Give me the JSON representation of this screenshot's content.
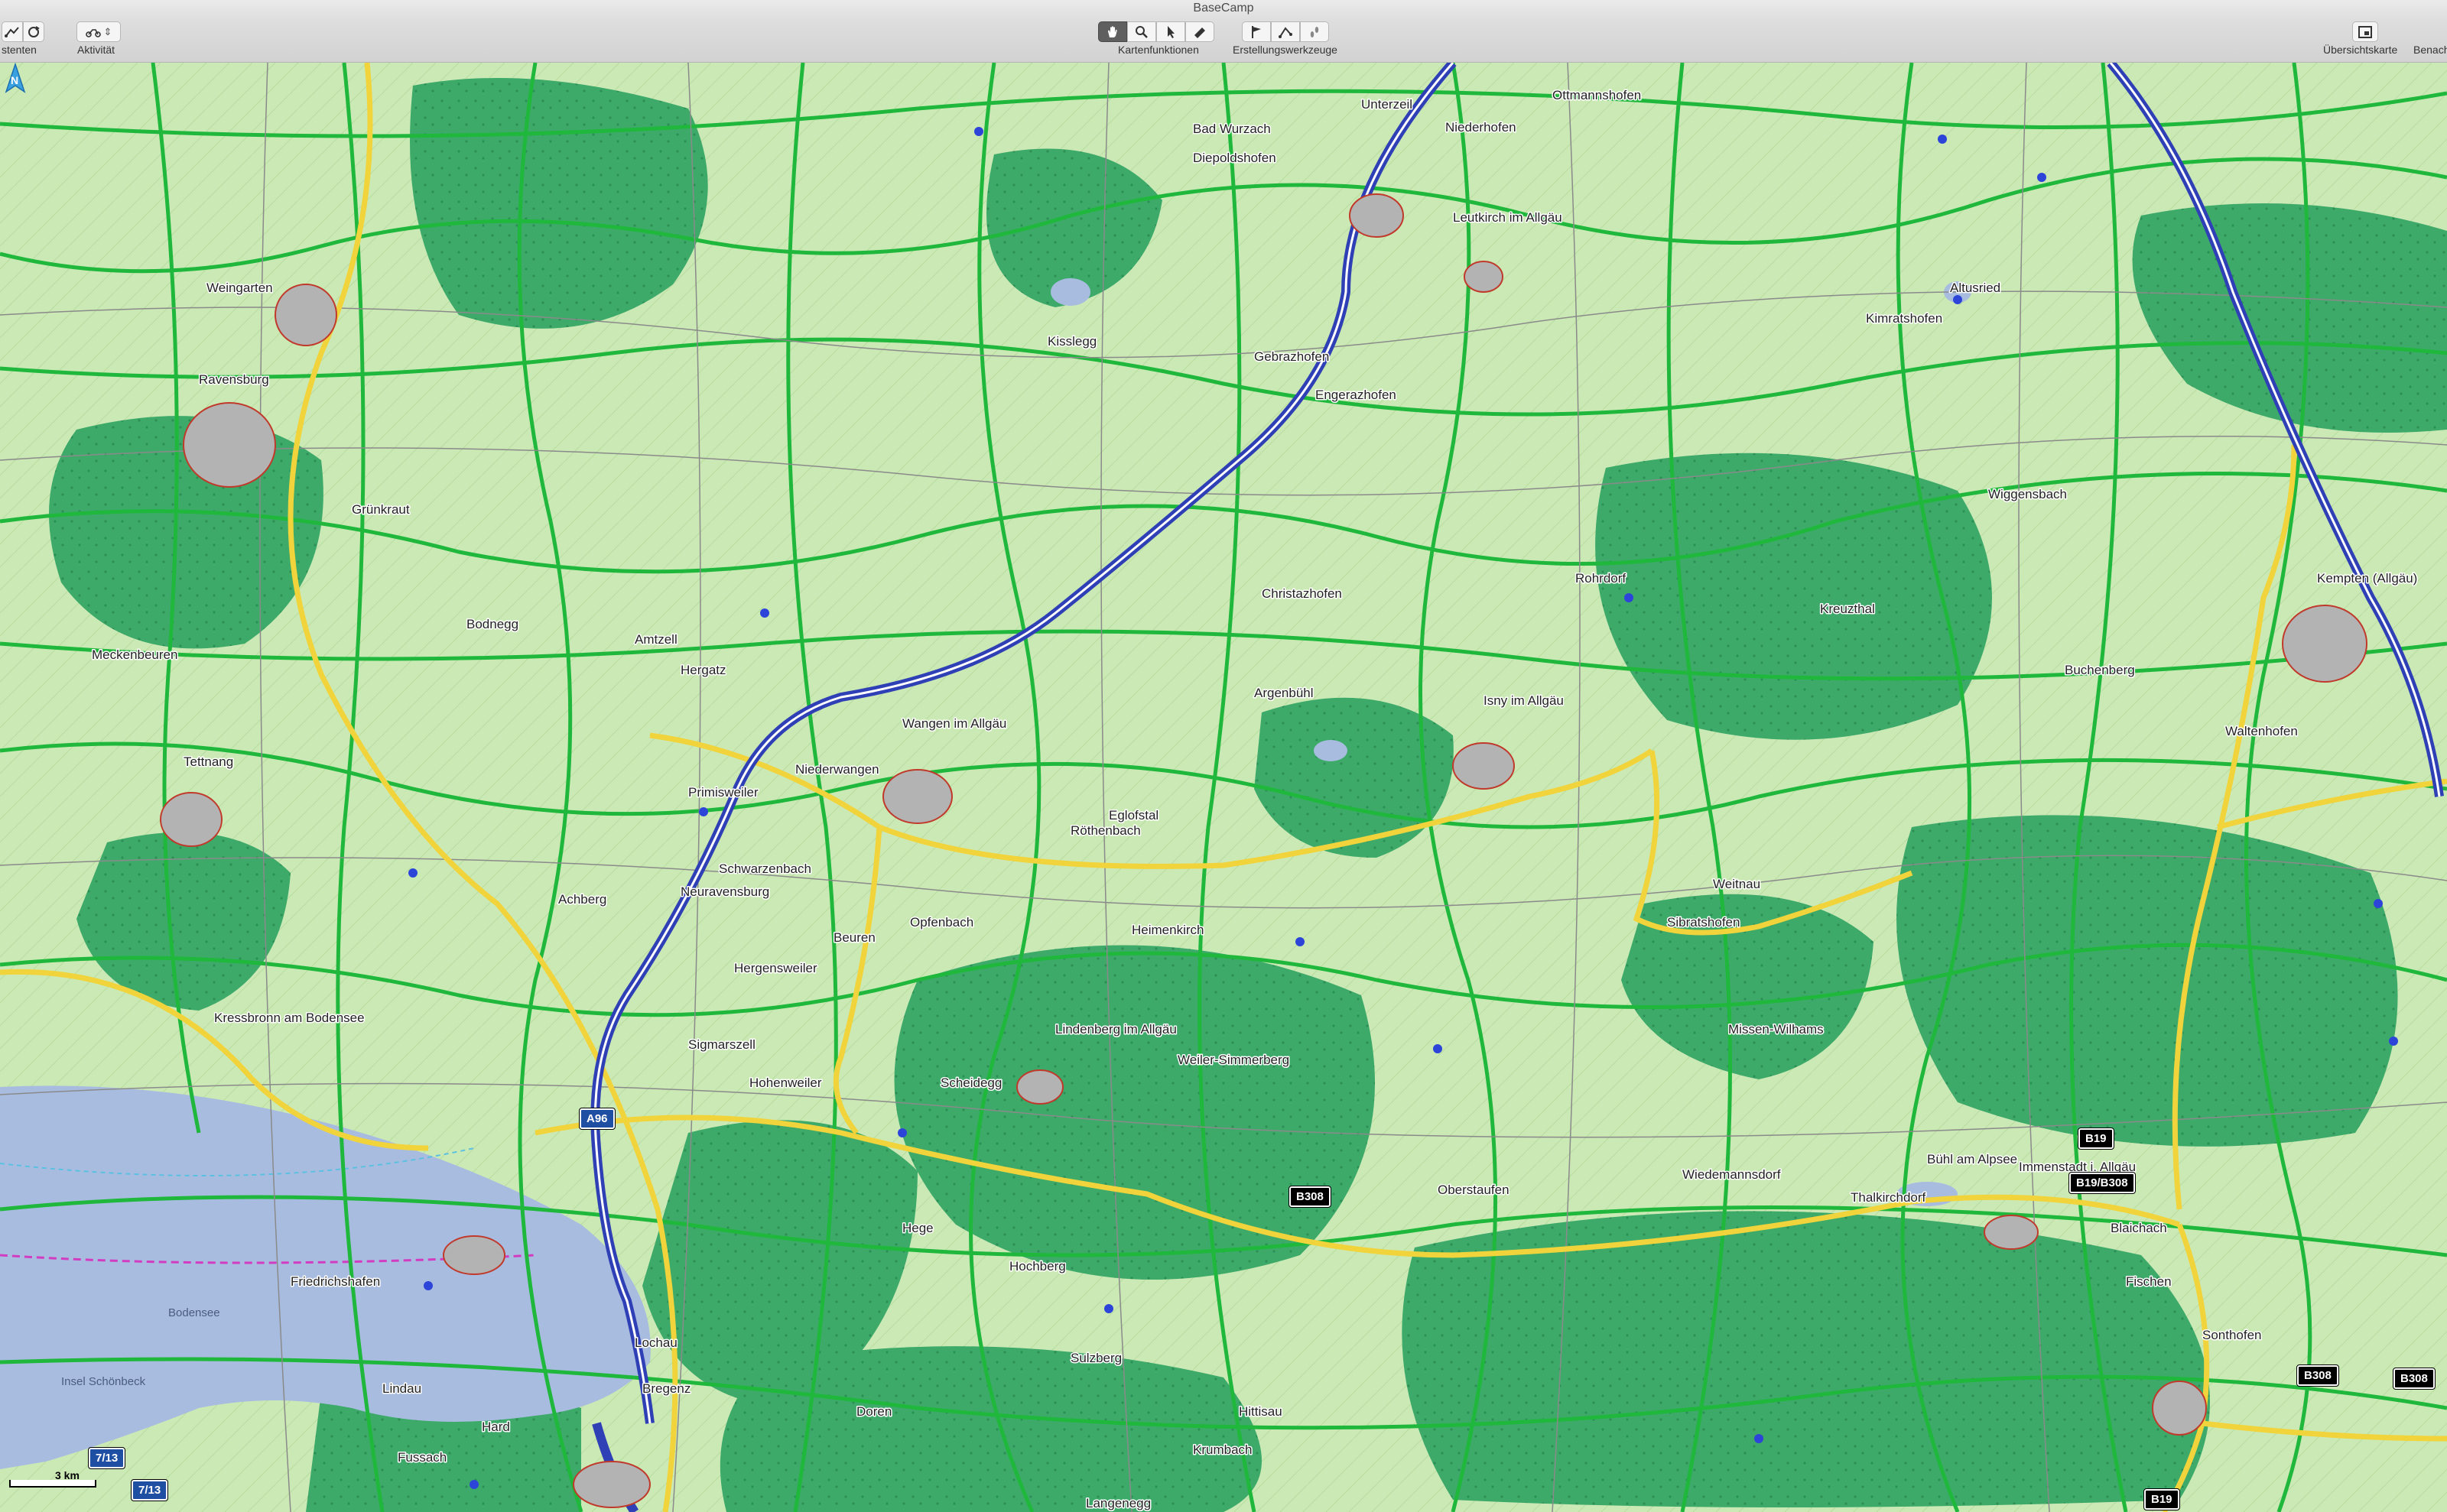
{
  "window": {
    "title": "BaseCamp"
  },
  "toolbar": {
    "left_label": "stenten",
    "activity_label": "Aktivität",
    "map_functions_label": "Kartenfunktionen",
    "creation_tools_label": "Erstellungswerkzeuge",
    "overview_map_label": "Übersichtskarte",
    "notifications_label": "Benach",
    "map_tools": [
      "hand-tool",
      "zoom-tool",
      "select-tool",
      "measure-tool"
    ],
    "creation_tools": [
      "waypoint-flag",
      "route-tool",
      "track-tool"
    ],
    "active_tool": "hand-tool"
  },
  "map": {
    "colors": {
      "forest": "#3daa6a",
      "meadow": "#cbe9b5",
      "water": "#a8bce0",
      "motorway": "#2f3fb5",
      "primary_road": "#f1d33b",
      "secondary_road": "#1fb83c"
    },
    "scale": {
      "label": "3 km"
    },
    "road_shields": [
      {
        "label": "A96"
      },
      {
        "label": "B308"
      },
      {
        "label": "B19"
      },
      {
        "label": "B19/B308"
      },
      {
        "label": "B308"
      },
      {
        "label": "B308"
      },
      {
        "label": "B19"
      },
      {
        "label": "7/13"
      },
      {
        "label": "7/13"
      }
    ],
    "water_labels": [
      "Bodensee",
      "Insel Schönbeck"
    ],
    "places": [
      "Ottmannshofen",
      "Leutkirch im Allgäu",
      "Kisslegg",
      "Bad Wurzach",
      "Ravensburg",
      "Weingarten",
      "Wangen im Allgäu",
      "Isny im Allgäu",
      "Kempten (Allgäu)",
      "Tettnang",
      "Friedrichshafen",
      "Lindau",
      "Bregenz",
      "Lindenberg im Allgäu",
      "Immenstadt i. Allgäu",
      "Sonthofen",
      "Oberstaufen",
      "Weiler-Simmerberg",
      "Hergatz",
      "Amtzell",
      "Argenbühl",
      "Kressbronn am Bodensee",
      "Meckenbeuren",
      "Grünkraut",
      "Bodnegg",
      "Waltenhofen",
      "Buchenberg",
      "Wiggensbach",
      "Altusried",
      "Kimratshofen",
      "Hergensweiler",
      "Sigmarszell",
      "Opfenbach",
      "Heimenkirch",
      "Röthenbach",
      "Scheidegg",
      "Hohenweiler",
      "Eglofstal",
      "Christazhofen",
      "Wiedemannsdorf",
      "Thalkirchdorf",
      "Bühl am Alpsee",
      "Blaichach",
      "Fischen",
      "Missen-Wilhams",
      "Weitnau",
      "Sibratshofen",
      "Rohrdorf",
      "Kreuzthal",
      "Diepoldshofen",
      "Unterzeil",
      "Niederhofen",
      "Gebrazhofen",
      "Engerazhofen",
      "Beuren",
      "Achberg",
      "Neuravensburg",
      "Niederwangen",
      "Primisweiler",
      "Schwarzenbach",
      "Hege",
      "Doren",
      "Langenegg",
      "Krumbach",
      "Hittisau",
      "Sulzberg",
      "Hochberg",
      "Lochau",
      "Fussach",
      "Hard"
    ]
  }
}
